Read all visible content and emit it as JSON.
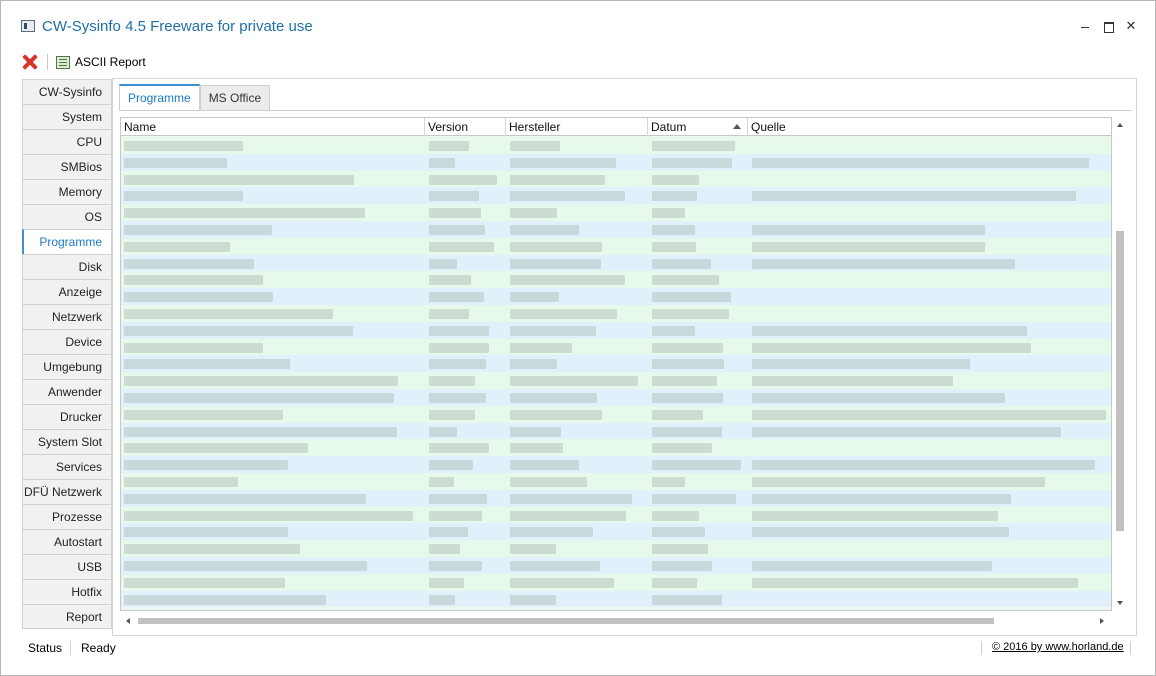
{
  "window": {
    "title": "CW-Sysinfo 4.5 Freeware for private use"
  },
  "toolbar": {
    "report_label": "ASCII Report"
  },
  "sidebar": {
    "items": [
      {
        "label": "CW-Sysinfo"
      },
      {
        "label": "System"
      },
      {
        "label": "CPU"
      },
      {
        "label": "SMBios"
      },
      {
        "label": "Memory"
      },
      {
        "label": "OS"
      },
      {
        "label": "Programme",
        "active": true
      },
      {
        "label": "Disk"
      },
      {
        "label": "Anzeige"
      },
      {
        "label": "Netzwerk"
      },
      {
        "label": "Device"
      },
      {
        "label": "Umgebung"
      },
      {
        "label": "Anwender"
      },
      {
        "label": "Drucker"
      },
      {
        "label": "System Slot"
      },
      {
        "label": "Services"
      },
      {
        "label": "DFÜ Netzwerk"
      },
      {
        "label": "Prozesse"
      },
      {
        "label": "Autostart"
      },
      {
        "label": "USB"
      },
      {
        "label": "Hotfix"
      },
      {
        "label": "Report"
      }
    ]
  },
  "tabs": [
    {
      "label": "Programme",
      "active": true
    },
    {
      "label": "MS Office"
    }
  ],
  "table": {
    "columns": [
      "Name",
      "Version",
      "Hersteller",
      "Datum",
      "Quelle"
    ],
    "sorted_column": "Datum",
    "sort_direction": "ascending",
    "row_count": 28,
    "row_text": "obscured"
  },
  "status": {
    "label": "Status",
    "value": "Ready",
    "copyright": "© 2016 by www.horland.de"
  },
  "colors": {
    "accent": "#1b7ac4",
    "row_green": "#e6f9eb",
    "row_blue": "#e1f0fb",
    "close_red": "#d9342b"
  },
  "icons": [
    "app-icon",
    "close-x-icon",
    "report-icon",
    "sort-ascending-icon",
    "minimize-icon",
    "maximize-icon",
    "window-close-icon"
  ]
}
